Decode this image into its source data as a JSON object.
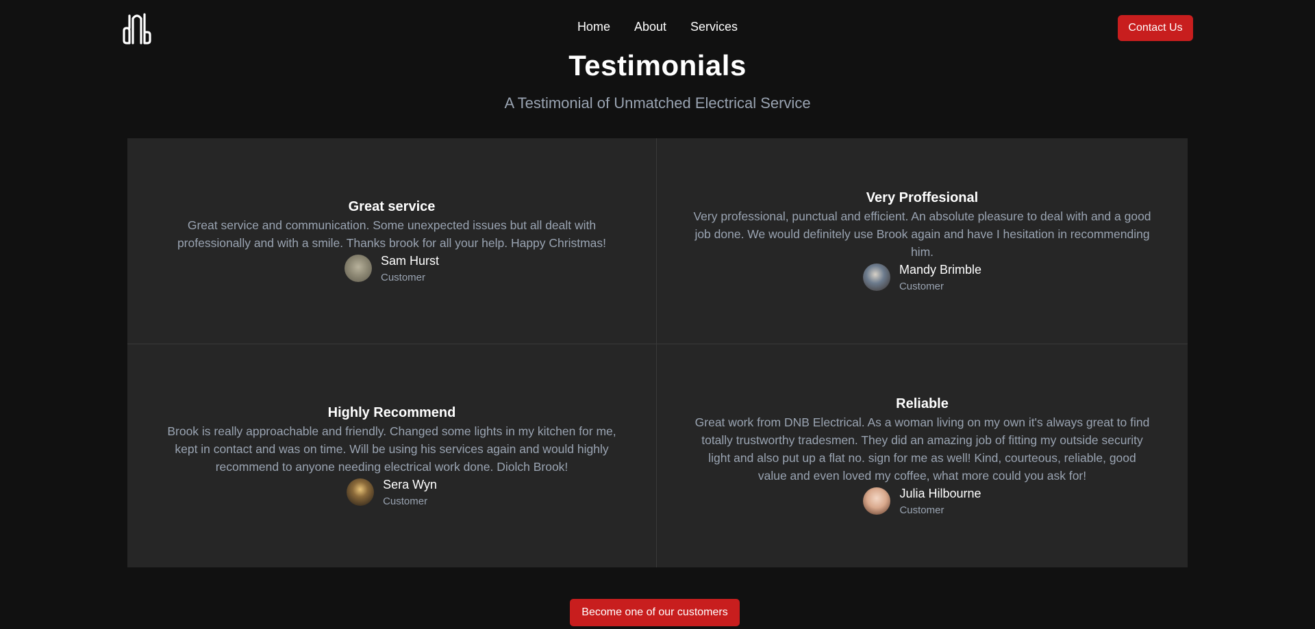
{
  "header": {
    "logo_icon": "dnb-logo-icon",
    "nav": [
      {
        "label": "Home"
      },
      {
        "label": "About"
      },
      {
        "label": "Services"
      }
    ],
    "contact_label": "Contact Us"
  },
  "section": {
    "title": "Testimonials",
    "subtitle": "A Testimonial of Unmatched Electrical Service"
  },
  "testimonials": [
    {
      "title": "Great service",
      "text": "Great service and communication. Some unexpected issues but all dealt with professionally and with a smile. Thanks brook for all your help. Happy Christmas!",
      "name": "Sam Hurst",
      "role": "Customer"
    },
    {
      "title": "Very Proffesional",
      "text": "Very professional, punctual and efficient. An absolute pleasure to deal with and a good job done. We would definitely use Brook again and have I hesitation in recommending him.",
      "name": "Mandy Brimble",
      "role": "Customer"
    },
    {
      "title": "Highly Recommend",
      "text": "Brook is really approachable and friendly. Changed some lights in my kitchen for me, kept in contact and was on time. Will be using his services again and would highly recommend to anyone needing electrical work done. Diolch Brook!",
      "name": "Sera Wyn",
      "role": "Customer"
    },
    {
      "title": "Reliable",
      "text": "Great work from DNB Electrical. As a woman living on my own it's always great to find totally trustworthy tradesmen. They did an amazing job of fitting my outside security light and also put up a flat no. sign for me as well! Kind, courteous, reliable, good value and even loved my coffee, what more could you ask for!",
      "name": "Julia Hilbourne",
      "role": "Customer"
    }
  ],
  "cta_label": "Become one of our customers",
  "colors": {
    "background": "#111111",
    "card": "#262626",
    "accent": "#c81e1e",
    "muted_text": "#9aa4b2"
  }
}
